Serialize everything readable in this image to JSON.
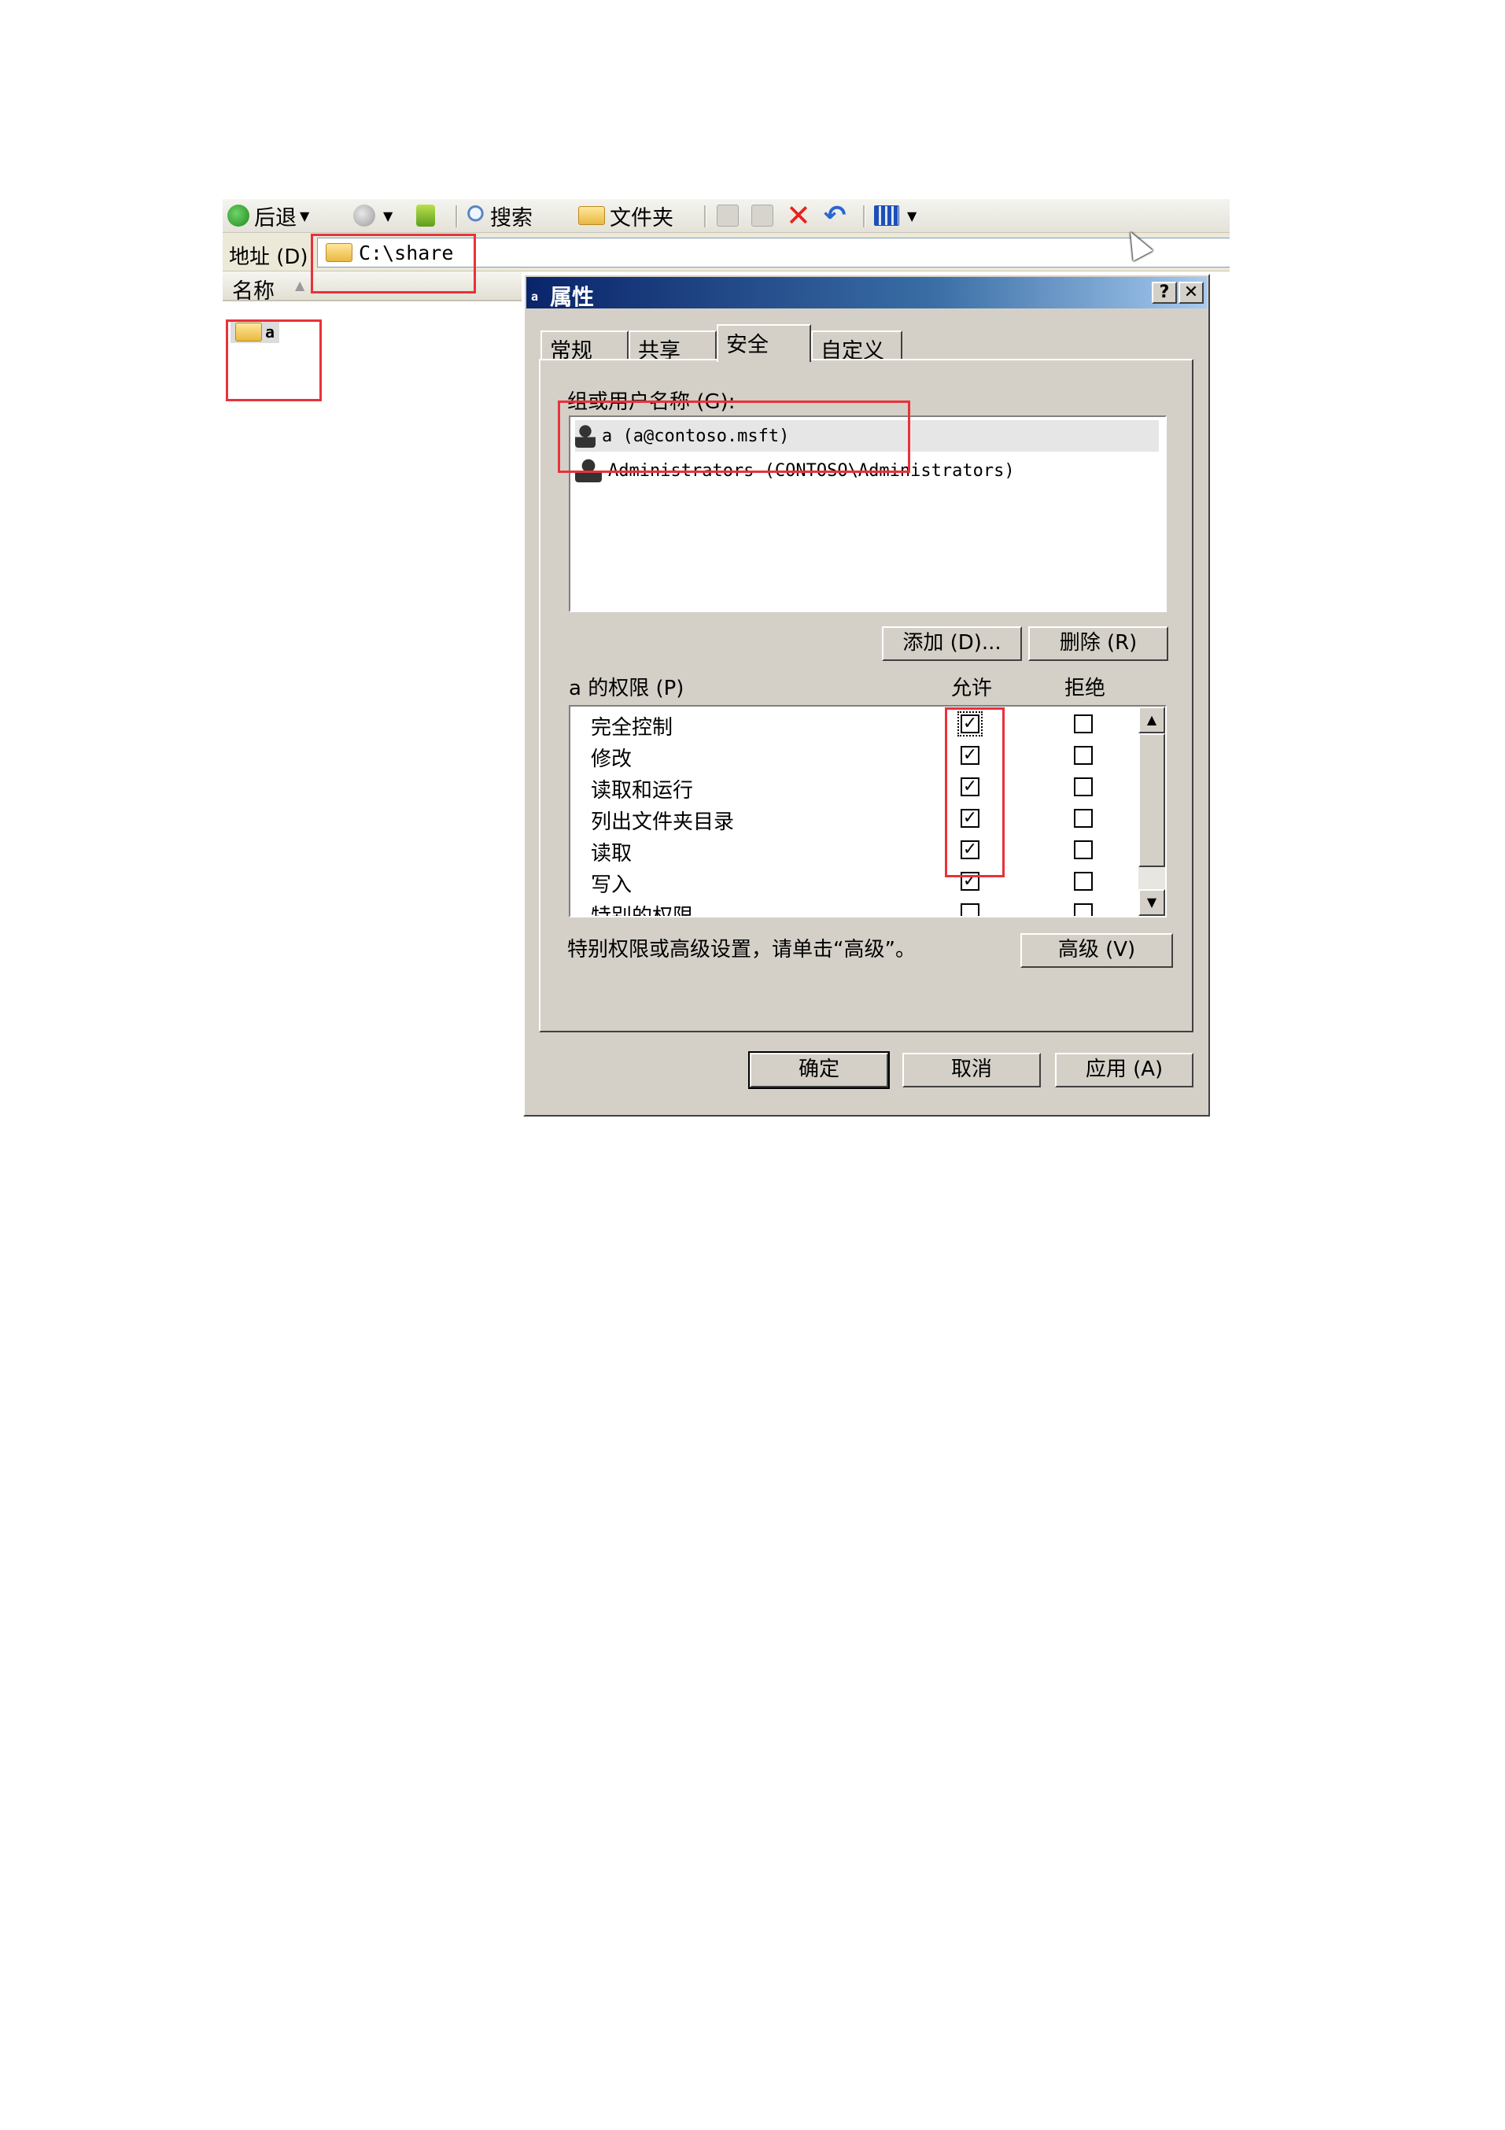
{
  "toolbar": {
    "back_label": "后退",
    "search_label": "搜索",
    "folders_label": "文件夹"
  },
  "address": {
    "label": "地址 (D)",
    "path": "C:\\share"
  },
  "filelist": {
    "column_header": "名称",
    "items": [
      {
        "name": "a"
      }
    ]
  },
  "dialog": {
    "title_icon_text": "a",
    "title": "属性",
    "help_label": "?",
    "close_label": "✕",
    "tabs": [
      "常规",
      "共享",
      "安全",
      "自定义"
    ],
    "active_tab": "安全",
    "groups_label": "组或用户名称 (G):",
    "users": [
      {
        "name": "a (a@contoso.msft)",
        "selected": true
      },
      {
        "name": "Administrators (CONTOSO\\Administrators)",
        "selected": false
      }
    ],
    "add_button": "添加 (D)...",
    "remove_button": "删除 (R)",
    "permissions_label": "a 的权限 (P)",
    "allow_header": "允许",
    "deny_header": "拒绝",
    "permissions": [
      {
        "name": "完全控制",
        "allow": true,
        "deny": false
      },
      {
        "name": "修改",
        "allow": true,
        "deny": false
      },
      {
        "name": "读取和运行",
        "allow": true,
        "deny": false
      },
      {
        "name": "列出文件夹目录",
        "allow": true,
        "deny": false
      },
      {
        "name": "读取",
        "allow": true,
        "deny": false
      },
      {
        "name": "写入",
        "allow": true,
        "deny": false
      },
      {
        "name": "特别的权限",
        "allow": false,
        "deny": false
      }
    ],
    "advanced_hint": "特别权限或高级设置，请单击“高级”。",
    "advanced_button": "高级 (V)",
    "ok_button": "确定",
    "cancel_button": "取消",
    "apply_button": "应用 (A)"
  },
  "colors": {
    "highlight": "#e8323a",
    "titlebar": "#0a246a",
    "dialog_bg": "#d4d0c8"
  }
}
